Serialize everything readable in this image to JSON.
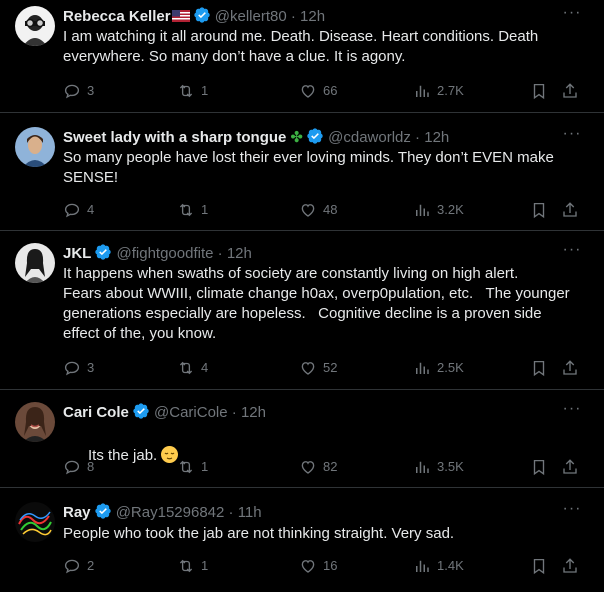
{
  "tweets": [
    {
      "name": "Rebecca Keller",
      "handle": "@kellert80",
      "time": "12h",
      "text": "I am watching it all around me. Death. Disease. Heart conditions. Death everywhere. So many don’t have a clue. It is agony.",
      "replies": "3",
      "retweets": "1",
      "likes": "66",
      "views": "2.7K"
    },
    {
      "name": "Sweet lady with a sharp tongue",
      "handle": "@cdaworldz",
      "time": "12h",
      "text": "So many people have lost their ever loving minds. They don’t EVEN make SENSE!",
      "replies": "4",
      "retweets": "1",
      "likes": "48",
      "views": "3.2K"
    },
    {
      "name": "JKL",
      "handle": "@fightgoodfite",
      "time": "12h",
      "text": "It happens when swaths of society are constantly living on high alert.\nFears about WWIII, climate change h0ax, overp0pulation, etc.   The younger generations especially are hopeless.   Cognitive decline is a proven side effect of the, you know.",
      "replies": "3",
      "retweets": "4",
      "likes": "52",
      "views": "2.5K"
    },
    {
      "name": "Cari Cole",
      "handle": "@CariCole",
      "time": "12h",
      "text": "Its the jab.",
      "replies": "8",
      "retweets": "1",
      "likes": "82",
      "views": "3.5K"
    },
    {
      "name": "Ray",
      "handle": "@Ray15296842",
      "time": "11h",
      "text": "People who took the jab are not thinking straight. Very sad.",
      "replies": "2",
      "retweets": "1",
      "likes": "16",
      "views": "1.4K"
    }
  ],
  "colors": {
    "verified": "#1d9bf0",
    "muted": "#71767b",
    "text": "#e7e9ea",
    "background": "#000000",
    "divider": "#2f3336"
  },
  "icons": [
    "reply-icon",
    "retweet-icon",
    "like-icon",
    "views-icon",
    "bookmark-icon",
    "share-icon",
    "more-icon",
    "verified-badge-icon"
  ]
}
